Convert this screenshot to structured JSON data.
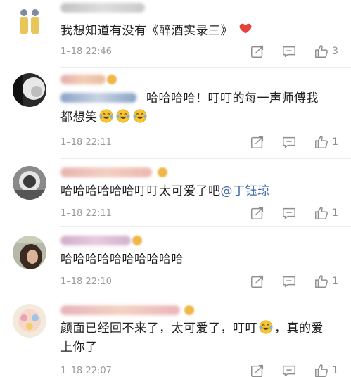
{
  "comments": [
    {
      "text": "我想知道有没有《醉酒实录三》",
      "heart": "heart-icon",
      "time": "1–18 22:46",
      "likes": "3"
    },
    {
      "text_a": "哈哈哈哈！叮叮的每一声师傅我",
      "text_b": "都想笑",
      "time": "1–18 22:11",
      "likes": "1"
    },
    {
      "text": "哈哈哈哈哈哈叮叮太可爱了吧",
      "mention": "@丁钰琼",
      "time": "1–18 22:11",
      "likes": "1"
    },
    {
      "text": "哈哈哈哈哈哈哈哈哈哈",
      "time": "1–18 22:10",
      "likes": "1"
    },
    {
      "text_a": "颜面已经回不来了，太可爱了，叮叮",
      "text_a2": "，真的爱",
      "text_b": "上你了",
      "time": "1–18 22:07",
      "likes": "1"
    }
  ],
  "icons": {
    "share": "share-icon",
    "comment": "comment-icon",
    "like": "thumbs-up-icon",
    "emoji": "laughing-crying-emoji"
  },
  "colors": {
    "mention": "#3d6aa8",
    "heart": "#e8413c",
    "meta": "#9a9a9a"
  }
}
